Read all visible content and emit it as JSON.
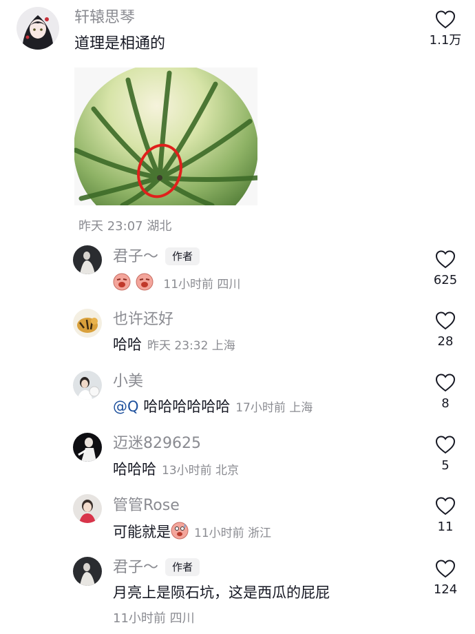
{
  "top_comment": {
    "username": "轩辕思琴",
    "text": "道理是相通的",
    "likes": "1.1万",
    "time": "昨天 23:07 湖北"
  },
  "replies": [
    {
      "username": "君子～",
      "badge": "作者",
      "text": "",
      "time": "11小时前 四川",
      "likes": "625"
    },
    {
      "username": "也许还好",
      "badge": "",
      "text": "哈哈",
      "time": "昨天 23:32 上海",
      "likes": "28"
    },
    {
      "username": "小美",
      "badge": "",
      "mention": "@Q",
      "text": "哈哈哈哈哈哈",
      "time": "17小时前 上海",
      "likes": "8"
    },
    {
      "username": "迈迷829625",
      "badge": "",
      "text": "哈哈哈",
      "time": "13小时前 北京",
      "likes": "5"
    },
    {
      "username": "管管Rose",
      "badge": "",
      "text": "可能就是",
      "time": "11小时前 浙江",
      "likes": "11"
    },
    {
      "username": "君子～",
      "badge": "作者",
      "text": "月亮上是陨石坑，这是西瓜的屁屁",
      "time": "11小时前 四川",
      "likes": "124"
    }
  ],
  "colors": {
    "secondary_text": "#8a8b91",
    "primary_text": "#161823",
    "mention": "#1c4f9c",
    "circle_annotation": "#e0201c"
  }
}
